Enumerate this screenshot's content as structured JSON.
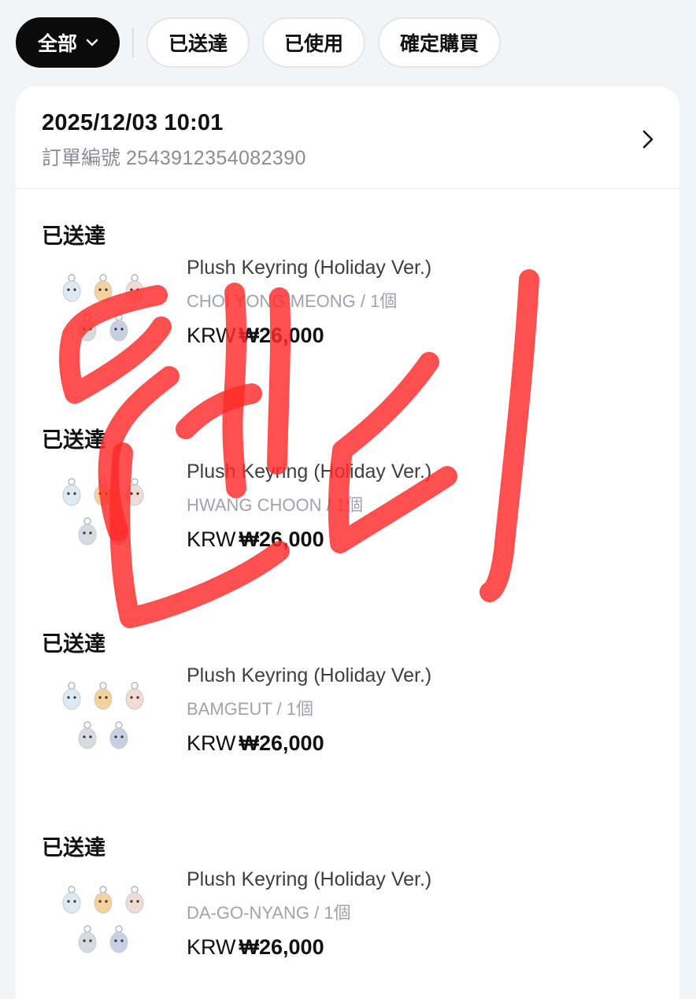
{
  "filters": {
    "all_label": "全部",
    "delivered_label": "已送達",
    "used_label": "已使用",
    "confirm_label": "確定購買"
  },
  "order": {
    "datetime": "2025/12/03 10:01",
    "number_label": "訂單編號",
    "number": "2543912354082390"
  },
  "items": [
    {
      "status": "已送達",
      "name": "Plush Keyring (Holiday Ver.)",
      "variant": "CHOI YONG MEONG / 1個",
      "currency": "KRW",
      "price": "₩26,000"
    },
    {
      "status": "已送達",
      "name": "Plush Keyring (Holiday Ver.)",
      "variant": "HWANG CHOON / 1個",
      "currency": "KRW",
      "price": "₩26,000"
    },
    {
      "status": "已送達",
      "name": "Plush Keyring (Holiday Ver.)",
      "variant": "BAMGEUT / 1個",
      "currency": "KRW",
      "price": "₩26,000"
    },
    {
      "status": "已送達",
      "name": "Plush Keyring (Holiday Ver.)",
      "variant": "DA-GO-NYANG / 1個",
      "currency": "KRW",
      "price": "₩26,000"
    }
  ],
  "colors": {
    "accent": "#0b0b0c",
    "muted": "#8a8d93",
    "scribble": "#ff2a2a"
  },
  "icons": [
    "chevron-down-icon",
    "chevron-right-icon",
    "keyring-plush-image"
  ]
}
